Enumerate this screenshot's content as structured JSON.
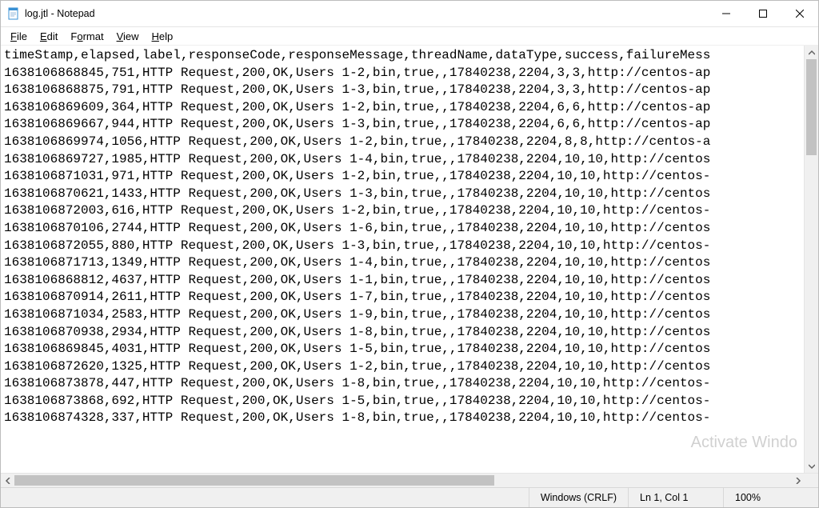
{
  "window": {
    "title": "log.jtl - Notepad"
  },
  "menu": {
    "file": "File",
    "edit": "Edit",
    "format": "Format",
    "view": "View",
    "help": "Help"
  },
  "content": {
    "lines": [
      "timeStamp,elapsed,label,responseCode,responseMessage,threadName,dataType,success,failureMess",
      "1638106868845,751,HTTP Request,200,OK,Users 1-2,bin,true,,17840238,2204,3,3,http://centos-ap",
      "1638106868875,791,HTTP Request,200,OK,Users 1-3,bin,true,,17840238,2204,3,3,http://centos-ap",
      "1638106869609,364,HTTP Request,200,OK,Users 1-2,bin,true,,17840238,2204,6,6,http://centos-ap",
      "1638106869667,944,HTTP Request,200,OK,Users 1-3,bin,true,,17840238,2204,6,6,http://centos-ap",
      "1638106869974,1056,HTTP Request,200,OK,Users 1-2,bin,true,,17840238,2204,8,8,http://centos-a",
      "1638106869727,1985,HTTP Request,200,OK,Users 1-4,bin,true,,17840238,2204,10,10,http://centos",
      "1638106871031,971,HTTP Request,200,OK,Users 1-2,bin,true,,17840238,2204,10,10,http://centos-",
      "1638106870621,1433,HTTP Request,200,OK,Users 1-3,bin,true,,17840238,2204,10,10,http://centos",
      "1638106872003,616,HTTP Request,200,OK,Users 1-2,bin,true,,17840238,2204,10,10,http://centos-",
      "1638106870106,2744,HTTP Request,200,OK,Users 1-6,bin,true,,17840238,2204,10,10,http://centos",
      "1638106872055,880,HTTP Request,200,OK,Users 1-3,bin,true,,17840238,2204,10,10,http://centos-",
      "1638106871713,1349,HTTP Request,200,OK,Users 1-4,bin,true,,17840238,2204,10,10,http://centos",
      "1638106868812,4637,HTTP Request,200,OK,Users 1-1,bin,true,,17840238,2204,10,10,http://centos",
      "1638106870914,2611,HTTP Request,200,OK,Users 1-7,bin,true,,17840238,2204,10,10,http://centos",
      "1638106871034,2583,HTTP Request,200,OK,Users 1-9,bin,true,,17840238,2204,10,10,http://centos",
      "1638106870938,2934,HTTP Request,200,OK,Users 1-8,bin,true,,17840238,2204,10,10,http://centos",
      "1638106869845,4031,HTTP Request,200,OK,Users 1-5,bin,true,,17840238,2204,10,10,http://centos",
      "1638106872620,1325,HTTP Request,200,OK,Users 1-2,bin,true,,17840238,2204,10,10,http://centos",
      "1638106873878,447,HTTP Request,200,OK,Users 1-8,bin,true,,17840238,2204,10,10,http://centos-",
      "1638106873868,692,HTTP Request,200,OK,Users 1-5,bin,true,,17840238,2204,10,10,http://centos-",
      "1638106874328,337,HTTP Request,200,OK,Users 1-8,bin,true,,17840238,2204,10,10,http://centos-"
    ]
  },
  "status": {
    "encoding": "Windows (CRLF)",
    "position": "Ln 1, Col 1",
    "zoom": "100%"
  },
  "watermark": "Activate Windo"
}
